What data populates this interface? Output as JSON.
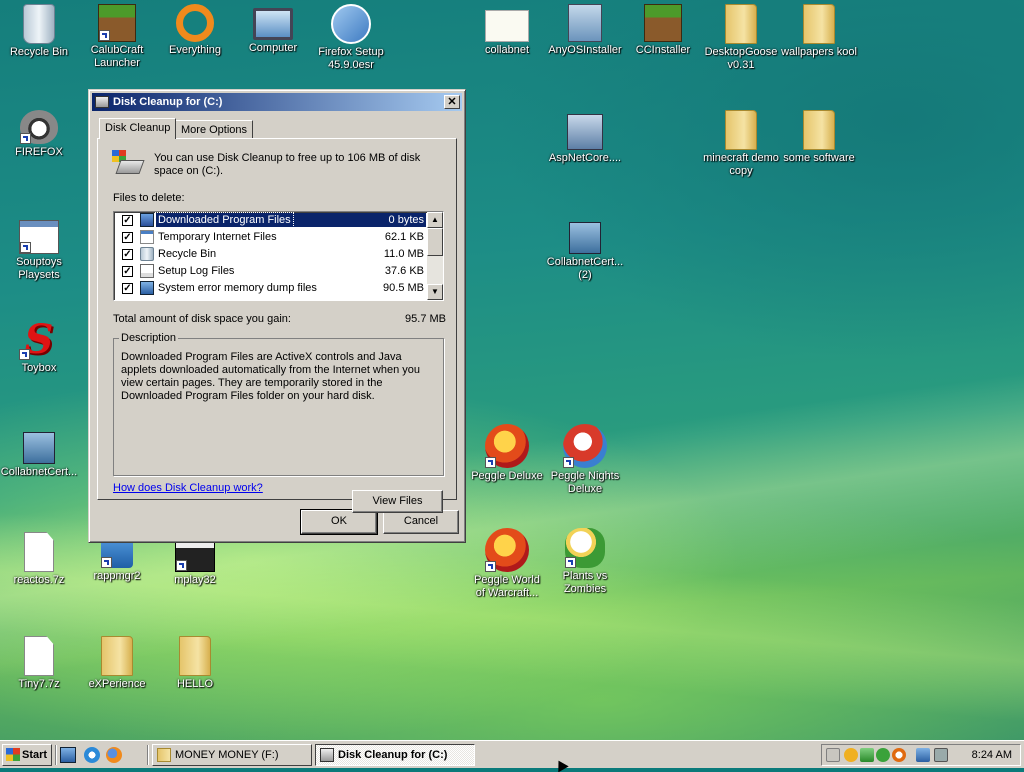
{
  "desktop": {
    "icons": [
      {
        "label": "Recycle Bin",
        "icon": "recycle-bin-icon"
      },
      {
        "label": "CalubCraft\nLauncher",
        "icon": "minecraft-grass-icon"
      },
      {
        "label": "Everything",
        "icon": "everything-search-icon"
      },
      {
        "label": "Computer",
        "icon": "computer-icon"
      },
      {
        "label": "Firefox Setup\n45.9.0esr",
        "icon": "setup-installer-icon"
      },
      {
        "label": "collabnet",
        "icon": "certificate-icon"
      },
      {
        "label": "AnyOSInstaller",
        "icon": "installer-icon"
      },
      {
        "label": "CCInstaller",
        "icon": "minecraft-grass-icon"
      },
      {
        "label": "DesktopGoose\nv0.31",
        "icon": "folder-icon"
      },
      {
        "label": "wallpapers kool",
        "icon": "folder-icon"
      },
      {
        "label": "FIREFOX",
        "icon": "raccoon-icon"
      },
      {
        "label": "AspNetCore....",
        "icon": "aspnet-installer-icon"
      },
      {
        "label": "minecraft demo\ncopy",
        "icon": "folder-icon"
      },
      {
        "label": "some software",
        "icon": "folder-icon"
      },
      {
        "label": "Souptoys\nPlaysets",
        "icon": "window-icon"
      },
      {
        "label": "CollabnetCert...\n(2)",
        "icon": "network-installer-icon"
      },
      {
        "label": "Toybox",
        "icon": "toybox-s-icon"
      },
      {
        "label": "CollabnetCert...",
        "icon": "network-installer-icon"
      },
      {
        "label": "Peggle Deluxe",
        "icon": "peggle-icon"
      },
      {
        "label": "Peggle Nights\nDeluxe",
        "icon": "peggle-nights-icon"
      },
      {
        "label": "reactos.7z",
        "icon": "file-page-icon"
      },
      {
        "label": "rappmgr2",
        "icon": "app-manager-icon"
      },
      {
        "label": "mplay32",
        "icon": "media-clapper-icon"
      },
      {
        "label": "Peggle World\nof Warcraft...",
        "icon": "peggle-icon"
      },
      {
        "label": "Plants vs\nZombies",
        "icon": "pvz-icon"
      },
      {
        "label": "Tiny7.7z",
        "icon": "file-page-icon"
      },
      {
        "label": "eXPerience",
        "icon": "folder-icon"
      },
      {
        "label": "HELLO",
        "icon": "folder-icon"
      }
    ]
  },
  "dialog": {
    "title": "Disk Cleanup for  (C:)",
    "tabs": [
      "Disk Cleanup",
      "More Options"
    ],
    "intro": "You can use Disk Cleanup to free up to 106 MB of disk space on  (C:).",
    "files_label": "Files to delete:",
    "files": [
      {
        "name": "Downloaded Program Files",
        "size": "0 bytes",
        "checked": true,
        "selected": true
      },
      {
        "name": "Temporary Internet Files",
        "size": "62.1 KB",
        "checked": true
      },
      {
        "name": "Recycle Bin",
        "size": "11.0 MB",
        "checked": true
      },
      {
        "name": "Setup Log Files",
        "size": "37.6 KB",
        "checked": true
      },
      {
        "name": "System error memory dump files",
        "size": "90.5 MB",
        "checked": true
      }
    ],
    "total_label": "Total amount of disk space you gain:",
    "total_value": "95.7 MB",
    "description_title": "Description",
    "description_text": "Downloaded Program Files are ActiveX controls and Java applets downloaded automatically from the Internet when you view certain pages. They are temporarily stored in the Downloaded Program Files folder on your hard disk.",
    "view_files_label": "View Files",
    "help_link": "How does Disk Cleanup work?",
    "ok_label": "OK",
    "cancel_label": "Cancel"
  },
  "taskbar": {
    "start_label": "Start",
    "tasks": [
      {
        "label": "MONEY MONEY (F:)"
      },
      {
        "label": "Disk Cleanup for  (C:)",
        "active": true
      }
    ],
    "clock": "8:24 AM"
  }
}
